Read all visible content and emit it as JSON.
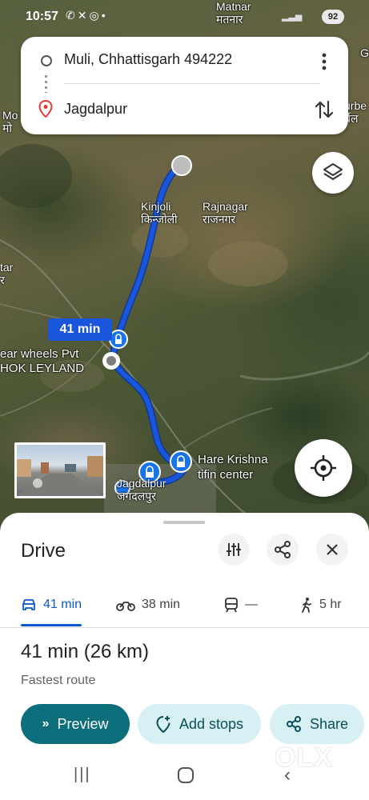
{
  "status_bar": {
    "time": "10:57",
    "icons": [
      "phone-icon",
      "missed-call-icon",
      "whatsapp-icon",
      "dot"
    ],
    "battery": "92"
  },
  "search": {
    "origin": "Muli, Chhattisgarh 494222",
    "destination": "Jagdalpur",
    "more_icon": "more-vert-icon",
    "swap_icon": "swap-vert-icon"
  },
  "map": {
    "labels": {
      "matnar_en": "Matnar",
      "matnar_hi": "मतनार",
      "kinjoli_en": "Kinjoli",
      "kinjoli_hi": "किन्जोली",
      "rajnagar_en": "Rajnagar",
      "rajnagar_hi": "राजनगर",
      "left_edge_top": "Mo",
      "left_edge_top_hi": "मो",
      "left_edge_mid": "tar",
      "left_edge_mid_hi": "र",
      "right_edge_top": "G",
      "right_edge_mid": "urbe",
      "right_edge_mid_hi": "र्बेल",
      "business_line1": "ear wheels Pvt",
      "business_line2": "HOK LEYLAND",
      "hare_krishna_line1": "Hare Krishna",
      "hare_krishna_line2": "tifin center",
      "jagdalpur_en": "Jagdalpur",
      "jagdalpur_hi": "जगदलपुर"
    },
    "route_time_badge": "41 min",
    "layers_icon": "layers-icon",
    "locate_icon": "my-location-icon",
    "route_color": "#1a56db"
  },
  "sheet": {
    "title": "Drive",
    "modes": [
      {
        "icon": "car-icon",
        "label": "41 min",
        "active": true
      },
      {
        "icon": "motorcycle-icon",
        "label": "38 min"
      },
      {
        "icon": "transit-icon",
        "label": "—"
      },
      {
        "icon": "walk-icon",
        "label": "5 hr"
      }
    ],
    "summary": "41 min (26 km)",
    "subtitle": "Fastest route",
    "buttons": {
      "preview": "Preview",
      "add_stops": "Add stops",
      "share": "Share"
    }
  },
  "watermark": "OLX",
  "colors": {
    "accent": "#0b57d0",
    "primary_button": "#0b6e7a",
    "tonal_button": "#d6f0f4"
  }
}
